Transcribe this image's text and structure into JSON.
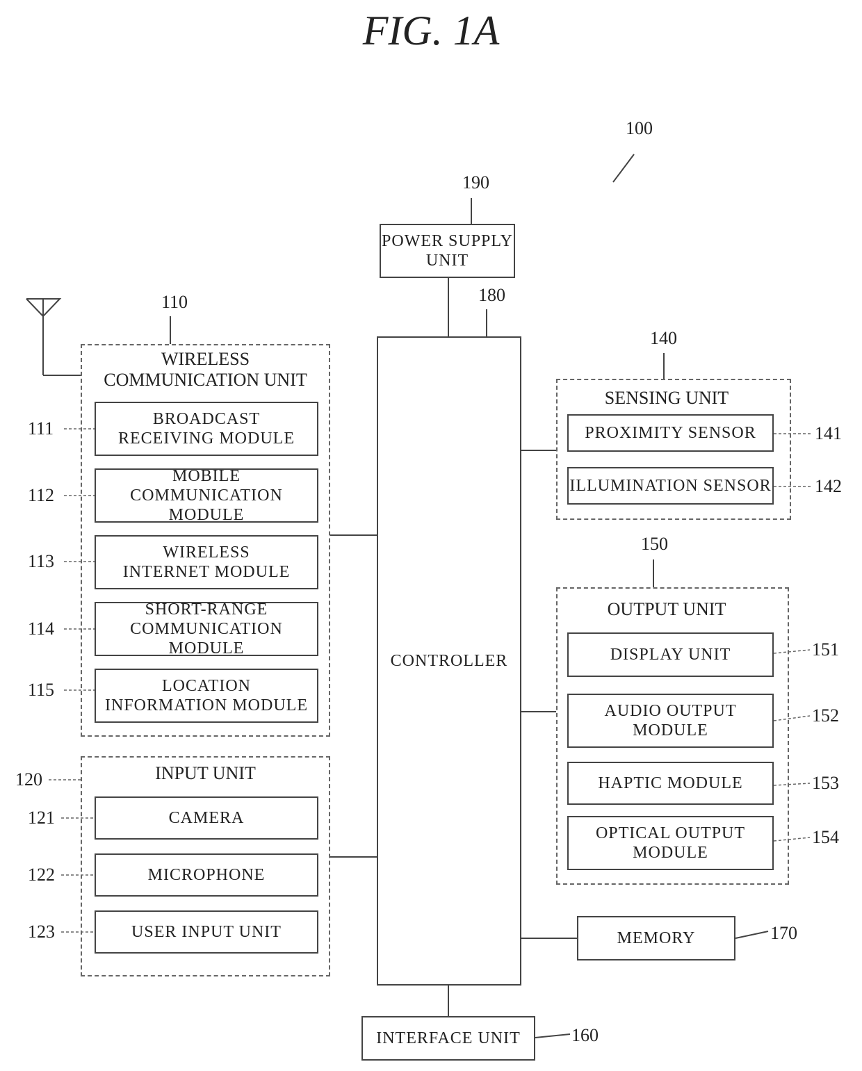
{
  "title": "FIG. 1A",
  "refs": {
    "device": "100",
    "wireless": "110",
    "m111": "111",
    "m112": "112",
    "m113": "113",
    "m114": "114",
    "m115": "115",
    "input": "120",
    "m121": "121",
    "m122": "122",
    "m123": "123",
    "sensing": "140",
    "m141": "141",
    "m142": "142",
    "output": "150",
    "m151": "151",
    "m152": "152",
    "m153": "153",
    "m154": "154",
    "interface": "160",
    "memory": "170",
    "controller": "180",
    "power": "190"
  },
  "labels": {
    "power": "POWER SUPPLY\nUNIT",
    "controller": "CONTROLLER",
    "wireless": "WIRELESS\nCOMMUNICATION UNIT",
    "m111": "BROADCAST\nRECEIVING MODULE",
    "m112": "MOBILE\nCOMMUNICATION MODULE",
    "m113": "WIRELESS\nINTERNET MODULE",
    "m114": "SHORT-RANGE\nCOMMUNICATION MODULE",
    "m115": "LOCATION\nINFORMATION MODULE",
    "input": "INPUT UNIT",
    "m121": "CAMERA",
    "m122": "MICROPHONE",
    "m123": "USER INPUT UNIT",
    "sensing": "SENSING UNIT",
    "m141": "PROXIMITY SENSOR",
    "m142": "ILLUMINATION SENSOR",
    "output": "OUTPUT UNIT",
    "m151": "DISPLAY UNIT",
    "m152": "AUDIO OUTPUT\nMODULE",
    "m153": "HAPTIC MODULE",
    "m154": "OPTICAL OUTPUT\nMODULE",
    "memory": "MEMORY",
    "interface": "INTERFACE UNIT"
  }
}
